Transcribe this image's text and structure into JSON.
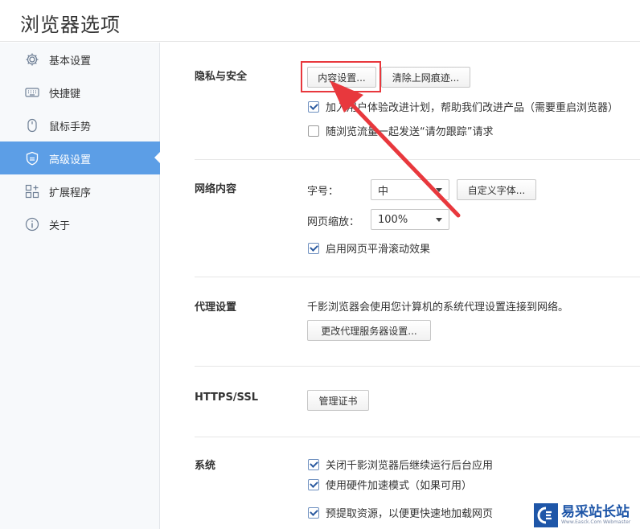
{
  "header": {
    "title": "浏览器选项"
  },
  "sidebar": {
    "items": [
      {
        "label": "基本设置",
        "icon": "gear-icon"
      },
      {
        "label": "快捷键",
        "icon": "keyboard-icon"
      },
      {
        "label": "鼠标手势",
        "icon": "mouse-icon"
      },
      {
        "label": "高级设置",
        "icon": "shield-icon",
        "active": true
      },
      {
        "label": "扩展程序",
        "icon": "extensions-icon"
      },
      {
        "label": "关于",
        "icon": "info-icon"
      }
    ]
  },
  "privacy": {
    "title": "隐私与安全",
    "content_settings_button": "内容设置...",
    "clear_history_button": "清除上网痕迹...",
    "join_program_label": "加入用户体验改进计划，帮助我们改进产品（需要重启浏览器）",
    "join_program_checked": true,
    "do_not_track_label": "随浏览流量一起发送“请勿跟踪”请求",
    "do_not_track_checked": false
  },
  "web_content": {
    "title": "网络内容",
    "font_size_label": "字号：",
    "font_size_value": "中",
    "custom_font_button": "自定义字体...",
    "zoom_label": "网页缩放：",
    "zoom_value": "100%",
    "smooth_scroll_label": "启用网页平滑滚动效果",
    "smooth_scroll_checked": true
  },
  "proxy": {
    "title": "代理设置",
    "description": "千影浏览器会使用您计算机的系统代理设置连接到网络。",
    "change_button": "更改代理服务器设置..."
  },
  "https": {
    "title": "HTTPS/SSL",
    "manage_certs_button": "管理证书"
  },
  "system": {
    "title": "系统",
    "items": [
      {
        "label": "关闭千影浏览器后继续运行后台应用",
        "checked": true
      },
      {
        "label": "使用硬件加速模式（如果可用）",
        "checked": true
      },
      {
        "label": "预提取资源，以便更快速地加载网页",
        "checked": true
      }
    ]
  },
  "annotation": {
    "highlight_color": "#e8383d",
    "accent_color": "#5c9ee6"
  },
  "watermark": {
    "main": "易采站长站",
    "sub": "Www.Easck.Com Webmaster"
  }
}
